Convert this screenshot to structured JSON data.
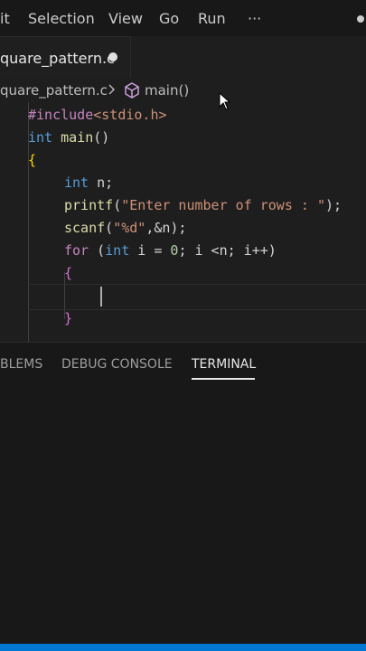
{
  "menubar": {
    "items": [
      "it",
      "Selection",
      "View",
      "Go",
      "Run",
      "···"
    ]
  },
  "tab": {
    "filename": "quare_pattern.c"
  },
  "breadcrumb": {
    "file": "quare_pattern.c",
    "separator": ">",
    "symbol": "main()"
  },
  "editor": {
    "lines": {
      "include_directive": "#include",
      "include_header": "<stdio.h>",
      "main_type": "int",
      "main_name": "main",
      "main_parens": "()",
      "open_brace": "{",
      "decl_type": "int",
      "decl_rest": " n;",
      "printf_fn": "printf",
      "printf_open": "(",
      "printf_str": "\"Enter number of rows : \"",
      "printf_close": ");",
      "scanf_fn": "scanf",
      "scanf_open": "(",
      "scanf_str": "\"%d\"",
      "scanf_rest": ",&n);",
      "for_kw": "for",
      "for_open": " (",
      "for_int": "int",
      "for_cond": " i = ",
      "for_zero": "0",
      "for_rest": "; i <n; i++)",
      "inner_open": "{",
      "inner_close": "}"
    }
  },
  "panel": {
    "tabs": [
      "BLEMS",
      "DEBUG CONSOLE",
      "TERMINAL"
    ],
    "active_tab": "TERMINAL"
  },
  "colors": {
    "keyword": "#569cd6",
    "function": "#dcdcaa",
    "string": "#ce9178",
    "preprocessor": "#c586c0",
    "brace": "#ffd700",
    "statusbar": "#0078d4"
  }
}
